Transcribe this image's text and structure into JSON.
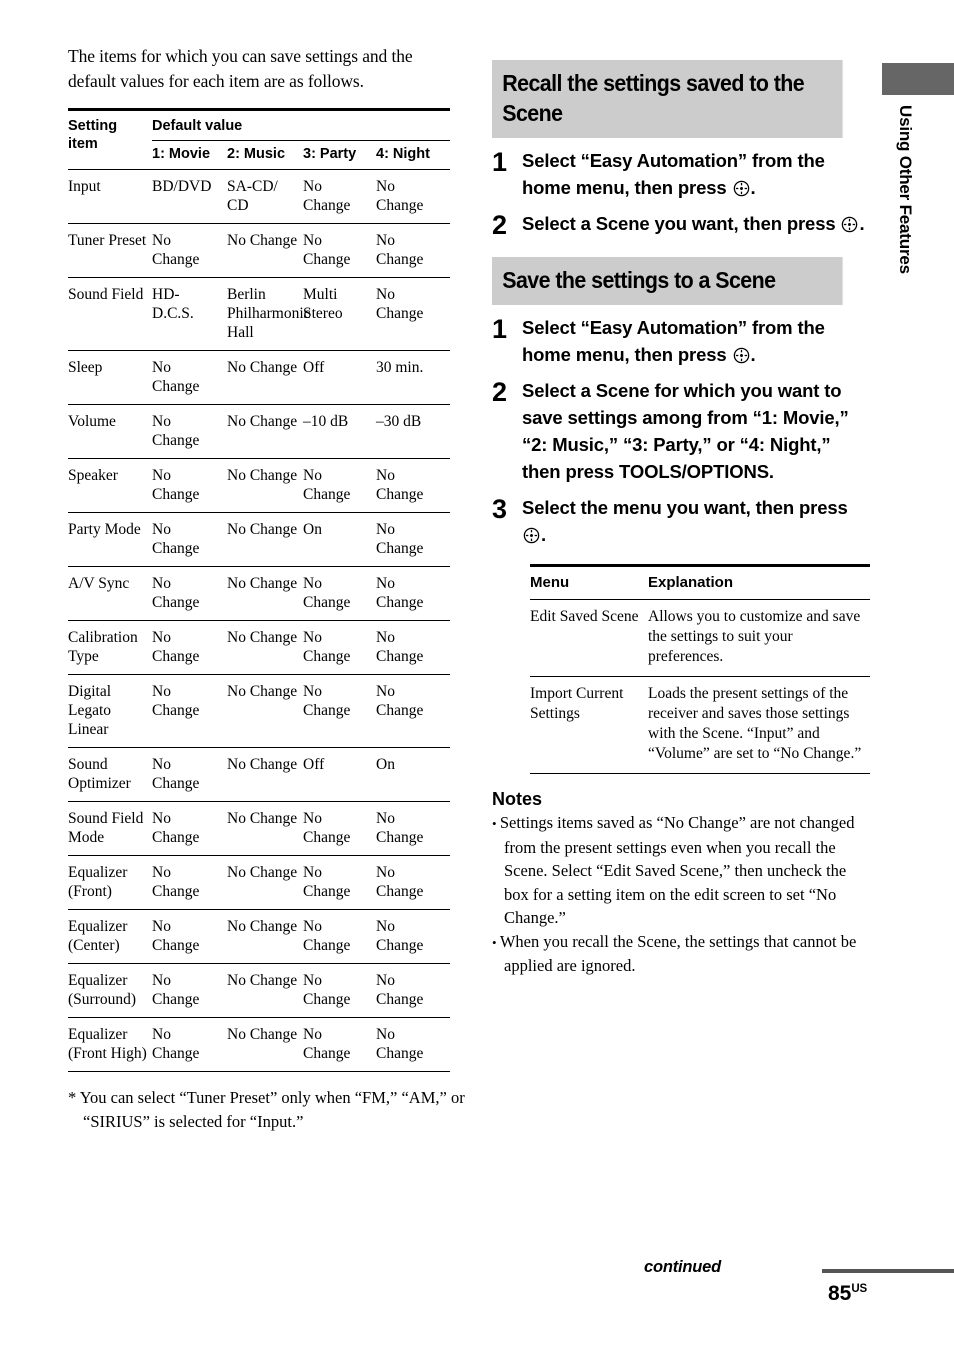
{
  "left": {
    "intro": "The items for which you can save settings and the default values for each item are as follows.",
    "table": {
      "col_header_setting_item": "Setting item",
      "col_header_group": "Default value",
      "scene_headers": [
        "1: Movie",
        "2: Music",
        "3: Party",
        "4: Night"
      ],
      "rows": [
        {
          "item": "Input",
          "values": [
            "BD/DVD",
            "SA-CD/ CD",
            "No Change",
            "No Change"
          ]
        },
        {
          "item": "Tuner Preset",
          "values": [
            "No Change",
            "No Change",
            "No Change",
            "No Change"
          ]
        },
        {
          "item": "Sound Field",
          "values": [
            "HD- D.C.S.",
            "Berlin Philharmonic Hall",
            "Multi Stereo",
            "No Change"
          ]
        },
        {
          "item": "Sleep",
          "values": [
            "No Change",
            "No Change",
            "Off",
            "30 min."
          ]
        },
        {
          "item": "Volume",
          "values": [
            "No Change",
            "No Change",
            "–10 dB",
            "–30 dB"
          ]
        },
        {
          "item": "Speaker",
          "values": [
            "No Change",
            "No Change",
            "No Change",
            "No Change"
          ]
        },
        {
          "item": "Party Mode",
          "values": [
            "No Change",
            "No Change",
            "On",
            "No Change"
          ]
        },
        {
          "item": "A/V Sync",
          "values": [
            "No Change",
            "No Change",
            "No Change",
            "No Change"
          ]
        },
        {
          "item": "Calibration Type",
          "values": [
            "No Change",
            "No Change",
            "No Change",
            "No Change"
          ]
        },
        {
          "item": "Digital Legato Linear",
          "values": [
            "No Change",
            "No Change",
            "No Change",
            "No Change"
          ]
        },
        {
          "item": "Sound Optimizer",
          "values": [
            "No Change",
            "No Change",
            "Off",
            "On"
          ]
        },
        {
          "item": "Sound Field Mode",
          "values": [
            "No Change",
            "No Change",
            "No Change",
            "No Change"
          ]
        },
        {
          "item": "Equalizer (Front)",
          "values": [
            "No Change",
            "No Change",
            "No Change",
            "No Change"
          ]
        },
        {
          "item": "Equalizer (Center)",
          "values": [
            "No Change",
            "No Change",
            "No Change",
            "No Change"
          ]
        },
        {
          "item": "Equalizer (Surround)",
          "values": [
            "No Change",
            "No Change",
            "No Change",
            "No Change"
          ]
        },
        {
          "item": "Equalizer (Front High)",
          "values": [
            "No Change",
            "No Change",
            "No Change",
            "No Change"
          ]
        }
      ]
    },
    "footnote": "* You can select “Tuner Preset” only when “FM,” “AM,” or “SIRIUS” is selected for “Input.”"
  },
  "right": {
    "section_recall": {
      "heading": "Recall the settings saved to the Scene",
      "steps": [
        {
          "num": "1",
          "text_before": "Select “Easy Automation” from the home menu, then press ",
          "icon": "enter-button-icon",
          "text_after": "."
        },
        {
          "num": "2",
          "text_before": "Select a Scene you want, then press ",
          "icon": "enter-button-icon",
          "text_after": "."
        }
      ]
    },
    "section_save": {
      "heading": "Save the settings to a Scene",
      "steps": [
        {
          "num": "1",
          "text_before": "Select “Easy Automation” from the home menu, then press ",
          "icon": "enter-button-icon",
          "text_after": "."
        },
        {
          "num": "2",
          "text_before": "Select a Scene for which you want to save settings among from “1: Movie,” “2: Music,” “3: Party,” or “4: Night,” then press TOOLS/OPTIONS.",
          "icon": null,
          "text_after": ""
        },
        {
          "num": "3",
          "text_before": "Select the menu you want, then press ",
          "icon": "enter-button-icon",
          "text_after": "."
        }
      ],
      "menu_table": {
        "headers": [
          "Menu",
          "Explanation"
        ],
        "rows": [
          {
            "menu": "Edit Saved Scene",
            "explanation": "Allows you to customize and save the settings to suit your preferences."
          },
          {
            "menu": "Import Current Settings",
            "explanation": "Loads the present settings of the receiver and saves those settings with the Scene. “Input” and “Volume” are set to “No Change.”"
          }
        ]
      }
    },
    "notes": {
      "title": "Notes",
      "items": [
        "Settings items saved as “No Change” are not changed from the present settings even when you recall the Scene. Select “Edit Saved Scene,” then uncheck the box for a setting item on the edit screen to set “No Change.”",
        "When you recall the Scene, the settings that cannot be applied are ignored."
      ]
    }
  },
  "side_tab": {
    "label": "Using Other Features",
    "block_color": "#666666"
  },
  "footer": {
    "continued": "continued",
    "page_number": "85",
    "page_suffix": "US"
  },
  "colors": {
    "heading_bar": "#cccccc",
    "side_tab": "#666666",
    "rule": "#000000",
    "footer_rule": "#555555"
  }
}
